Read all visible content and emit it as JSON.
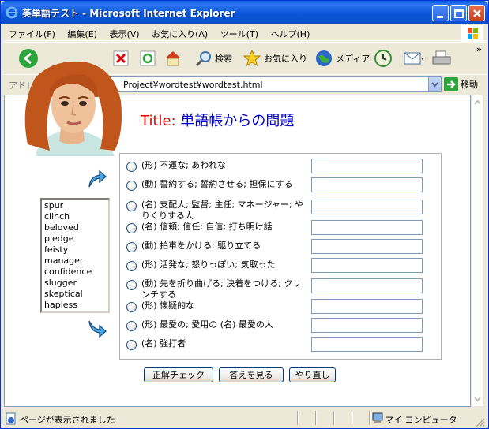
{
  "window": {
    "title": "英単語テスト - Microsoft Internet Explorer"
  },
  "menu": {
    "items": [
      "ファイル(F)",
      "編集(E)",
      "表示(V)",
      "お気に入り(A)",
      "ツール(T)",
      "ヘルプ(H)"
    ]
  },
  "toolbar": {
    "search_label": "検索",
    "favorites_label": "お気に入り",
    "media_label": "メディア",
    "more": "»"
  },
  "address": {
    "label": "アドレス",
    "url": "Project¥wordtest¥wordtest.html",
    "go_label": "移動"
  },
  "page": {
    "title_prefix": "Title:",
    "title_text": "単語帳からの問題",
    "words": [
      "spur",
      "clinch",
      "beloved",
      "pledge",
      "feisty",
      "manager",
      "confidence",
      "slugger",
      "skeptical",
      "hapless"
    ],
    "questions": [
      "(形) 不運な; あわれな",
      "(動) 誓約する; 誓約させる; 担保にする",
      "(名) 支配人; 監督; 主任; マネージャー; やりくりする人",
      "(名) 信頼; 信任; 自信; 打ち明け話",
      "(動) 拍車をかける; 駆り立てる",
      "(形) 活発な; 怒りっぽい; 気取った",
      "(動) 先を折り曲げる; 決着をつける; クリンチする",
      "(形) 懐疑的な",
      "(形) 最愛の; 愛用の (名) 最愛の人",
      "(名) 強打者"
    ],
    "buttons": {
      "check": "正解チェック",
      "show": "答えを見る",
      "retry": "やり直し"
    }
  },
  "status": {
    "text": "ページが表示されました",
    "zone": "マイ コンピュータ"
  },
  "colors": {
    "title_prefix": "#e00000",
    "title_text": "#0000c8",
    "titlebar": "#0a5fdc"
  }
}
